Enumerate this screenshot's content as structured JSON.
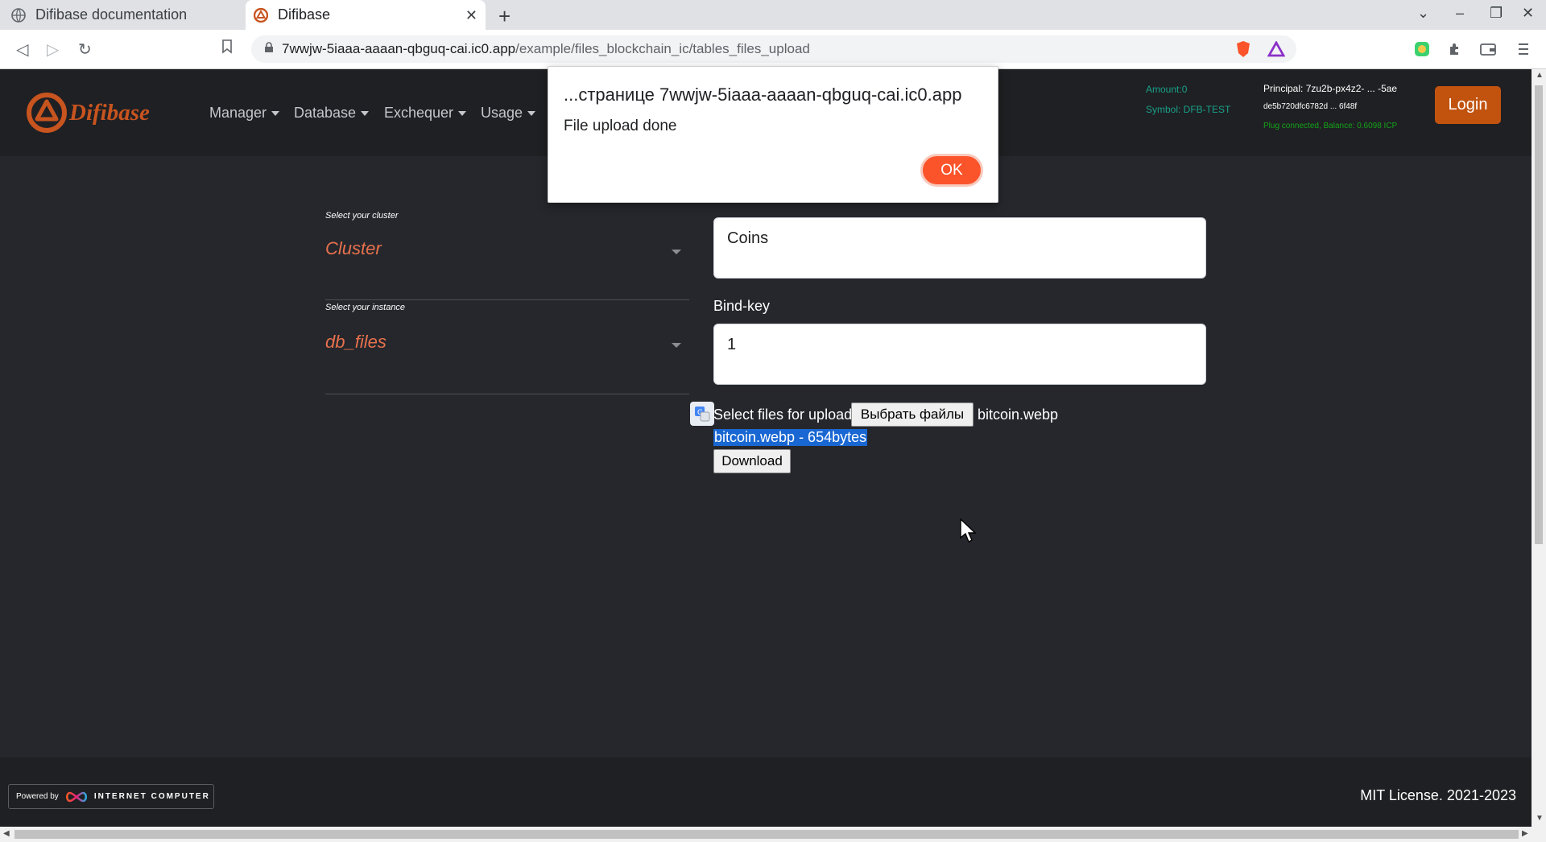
{
  "browser": {
    "tabs": [
      {
        "title": "Difibase documentation"
      },
      {
        "title": "Difibase"
      }
    ],
    "url_host": "7wwjw-5iaaa-aaaan-qbguq-cai.ic0.app",
    "url_path": "/example/files_blockchain_ic/tables_files_upload"
  },
  "navbar": {
    "brand": "Difibase",
    "menus": [
      "Manager",
      "Database",
      "Exchequer",
      "Usage"
    ],
    "amount": "Amount:0",
    "symbol": "Symbol: DFB-TEST",
    "principal": "Principal: 7zu2b-px4z2- ... -5ae",
    "account": "de5b720dfc6782d ... 6f48f",
    "plug_status": "Plug connected, Balance: 0.6098 ICP",
    "login_label": "Login"
  },
  "form": {
    "cluster_hint": "Select your cluster",
    "cluster_value": "Cluster",
    "instance_hint": "Select your instance",
    "instance_value": "db_files",
    "table_value": "Coins",
    "bindkey_label": "Bind-key",
    "bindkey_value": "1",
    "upload_label": "Select files for upload",
    "choose_button": "Выбрать файлы",
    "chosen_file": "bitcoin.webp",
    "file_info": "bitcoin.webp - 654bytes",
    "download_button": "Download"
  },
  "footer": {
    "powered_by": "Powered by",
    "ic_label": "INTERNET COMPUTER",
    "license": "MIT License. 2021-2023"
  },
  "dialog": {
    "title": "...странице 7wwjw-5iaaa-aaaan-qbguq-cai.ic0.app",
    "message": "File upload done",
    "ok_label": "OK"
  },
  "colors": {
    "brand": "#c8541f",
    "accent_select": "#e8714d",
    "login": "#c1530f",
    "dialog_ok": "#fb542b",
    "status_teal": "#19a08a",
    "status_green": "#14a31a"
  }
}
